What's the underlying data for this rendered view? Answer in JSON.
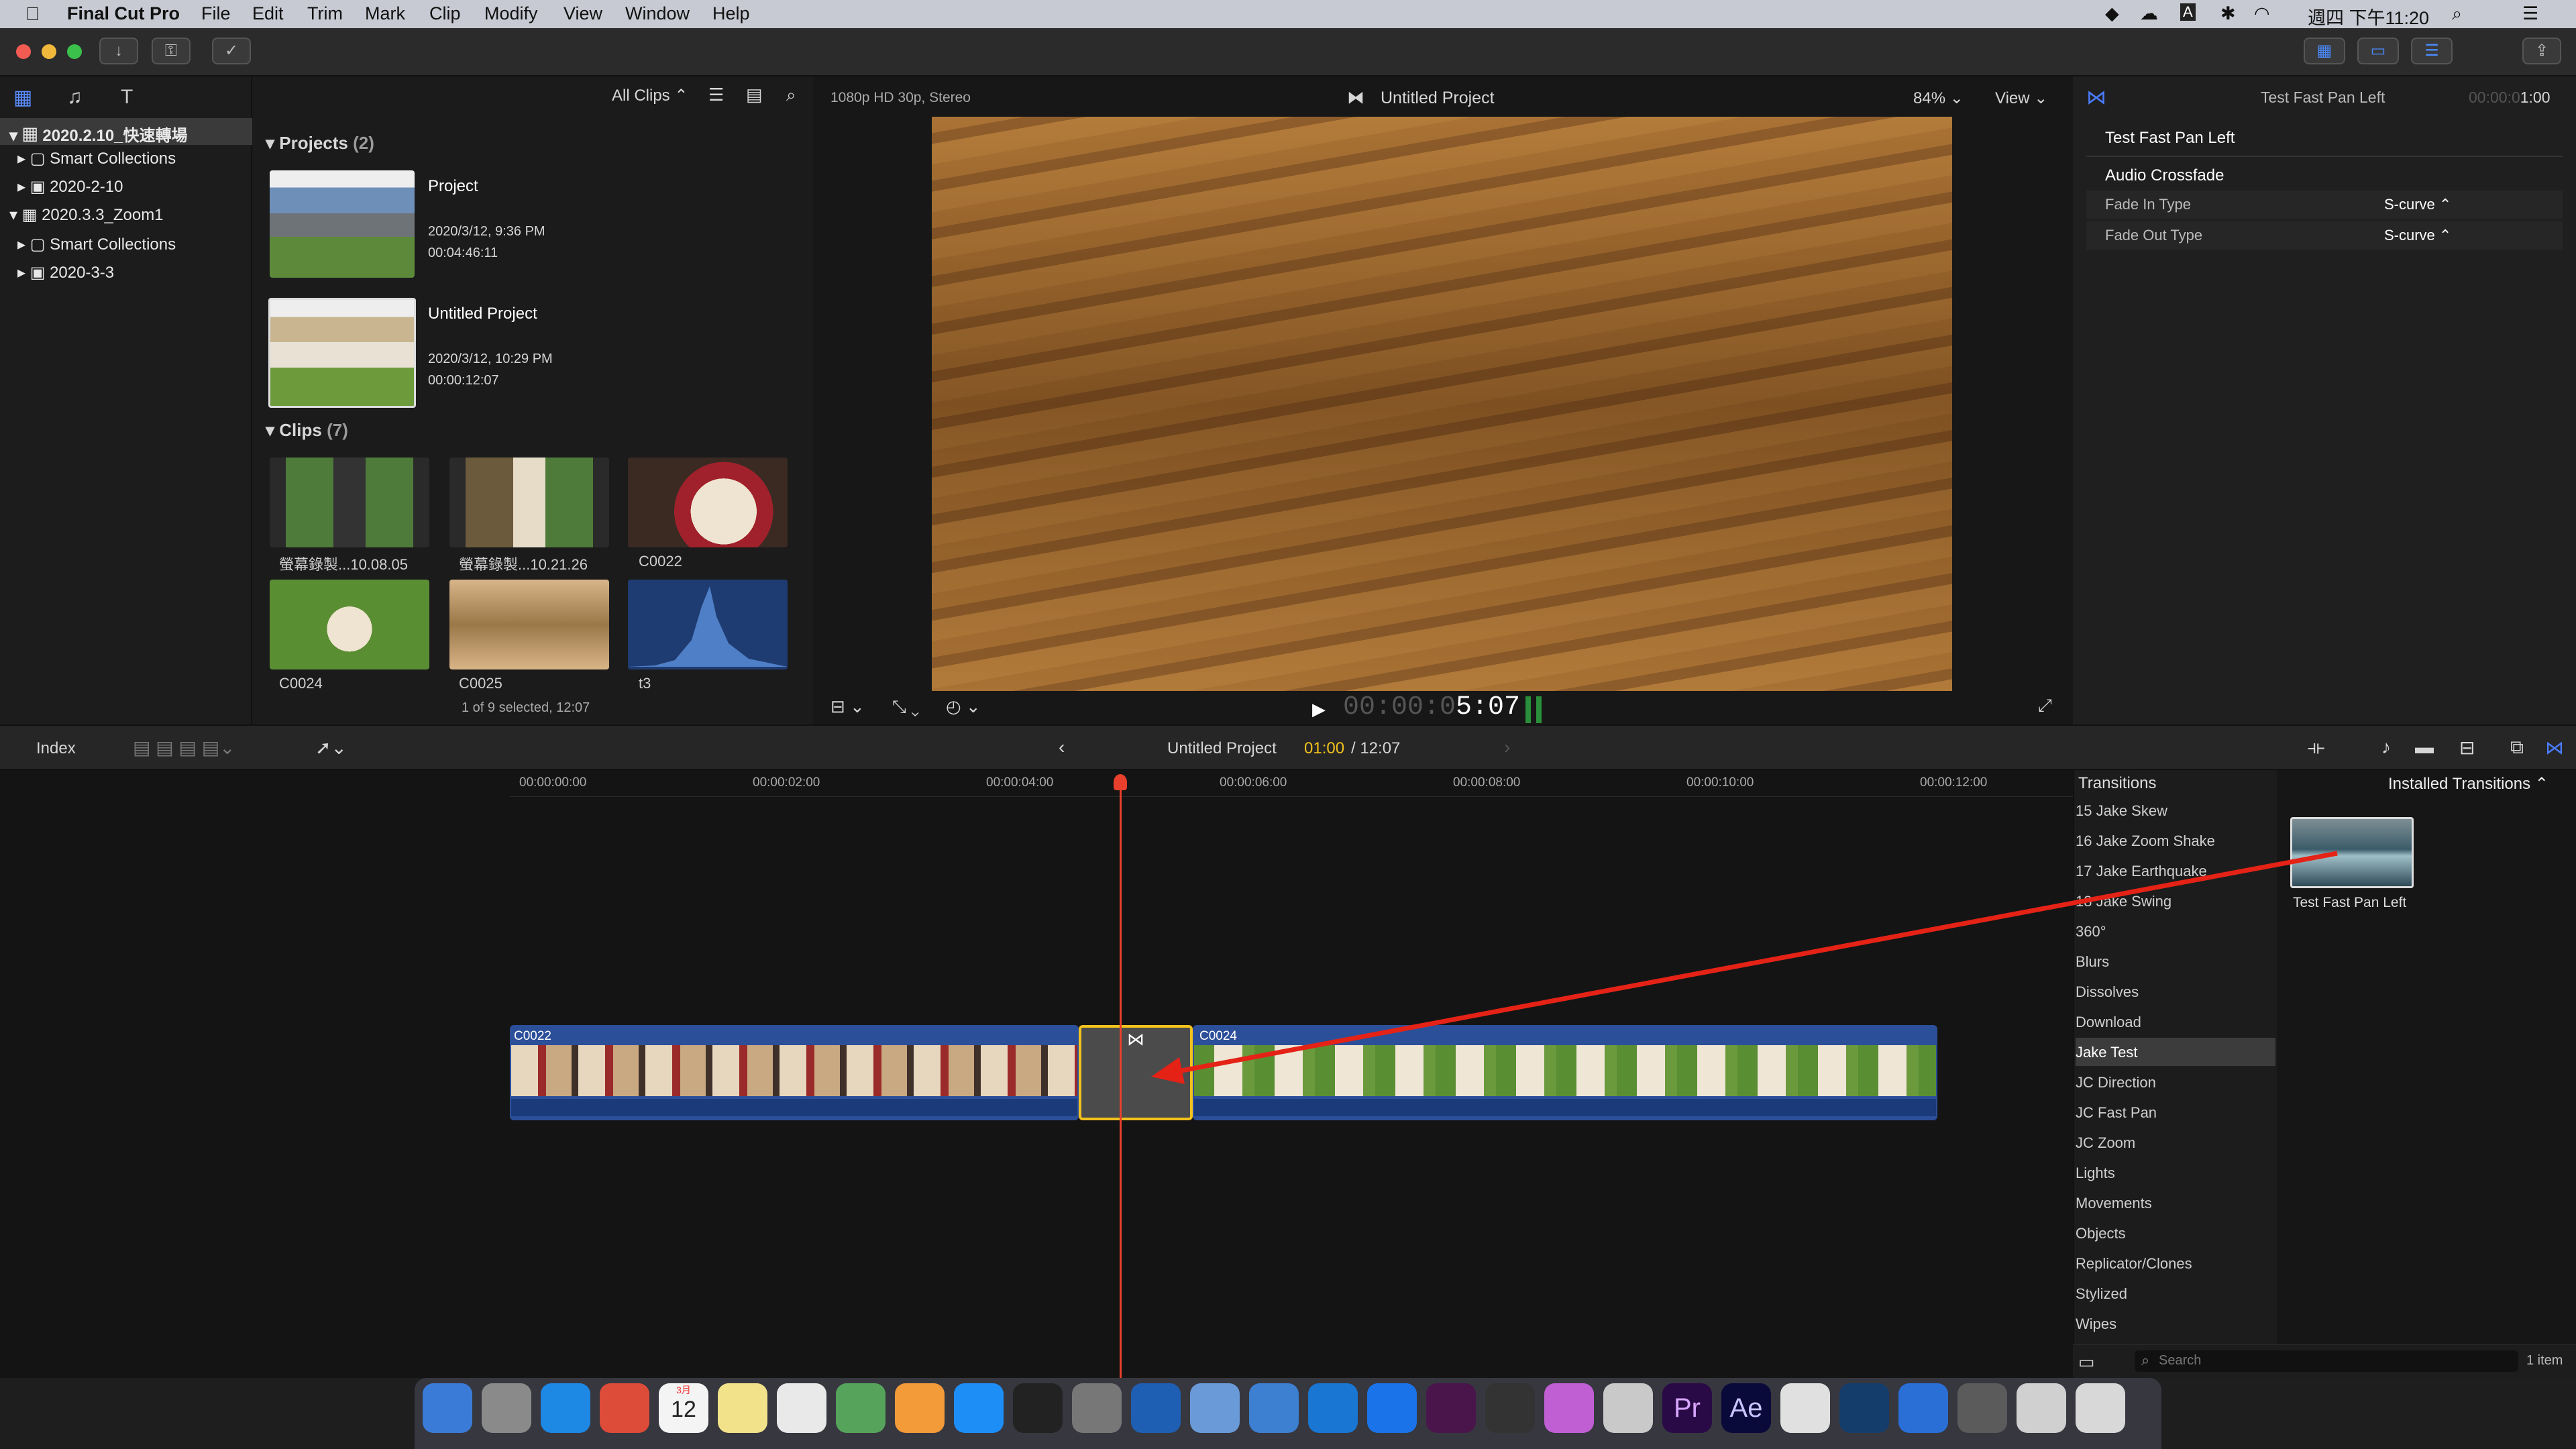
{
  "menubar": {
    "app": "Final Cut Pro",
    "items": [
      "File",
      "Edit",
      "Trim",
      "Mark",
      "Clip",
      "Modify",
      "View",
      "Window",
      "Help"
    ],
    "clock": "週四 下午11:20"
  },
  "browser": {
    "libraries": [
      {
        "label": "2020.2.10_快速轉場",
        "children": [
          "Smart Collections",
          "2020-2-10"
        ]
      },
      {
        "label": "2020.3.3_Zoom1",
        "children": [
          "Smart Collections",
          "2020-3-3"
        ]
      }
    ],
    "filter": "All Clips",
    "projects_header": "Projects",
    "projects_count": "(2)",
    "projects": [
      {
        "name": "Project",
        "date": "2020/3/12, 9:36 PM",
        "duration": "00:04:46:11"
      },
      {
        "name": "Untitled Project",
        "date": "2020/3/12, 10:29 PM",
        "duration": "00:00:12:07"
      }
    ],
    "clips_header": "Clips",
    "clips_count": "(7)",
    "clips": [
      "螢幕錄製...10.08.05",
      "螢幕錄製...10.21.26",
      "C0022",
      "C0024",
      "C0025",
      "t3"
    ],
    "status": "1 of 9 selected, 12:07"
  },
  "viewer": {
    "format": "1080p HD 30p, Stereo",
    "title": "Untitled Project",
    "zoom": "84%",
    "view": "View",
    "timecode_dim": "00:00:0",
    "timecode": "5:07"
  },
  "inspector": {
    "title": "Test Fast Pan Left",
    "duration": "1:00",
    "duration_dim": "00:00:0",
    "heading": "Test Fast Pan Left",
    "section": "Audio Crossfade",
    "rows": [
      {
        "label": "Fade In Type",
        "value": "S-curve"
      },
      {
        "label": "Fade Out Type",
        "value": "S-curve"
      }
    ]
  },
  "timeline": {
    "index": "Index",
    "project": "Untitled Project",
    "position": "01:00",
    "total": "/ 12:07",
    "ruler": [
      "00:00:00:00",
      "00:00:02:00",
      "00:00:04:00",
      "00:00:06:00",
      "00:00:08:00",
      "00:00:10:00",
      "00:00:12:00"
    ],
    "clips": [
      {
        "name": "C0022"
      },
      {
        "name": "C0024"
      }
    ]
  },
  "transitions": {
    "header": "Transitions",
    "installed": "Installed Transitions",
    "categories": [
      "15 Jake Skew",
      "16 Jake Zoom Shake",
      "17 Jake Earthquake",
      "18 Jake Swing",
      "360°",
      "Blurs",
      "Dissolves",
      "Download",
      "Jake Test",
      "JC Direction",
      "JC Fast Pan",
      "JC Zoom",
      "Lights",
      "Movements",
      "Objects",
      "Replicator/Clones",
      "Stylized",
      "Wipes"
    ],
    "selected": "Jake Test",
    "item": "Test Fast Pan Left",
    "search_placeholder": "Search",
    "count": "1 item"
  },
  "dock": {
    "calendar_day": "12",
    "calendar_month": "3月",
    "pr": "Pr",
    "ae": "Ae"
  },
  "colors": {
    "accent": "#f3c21d",
    "playhead": "#e8402c",
    "clip": "#2c4f9a",
    "arrow": "#e52216"
  }
}
